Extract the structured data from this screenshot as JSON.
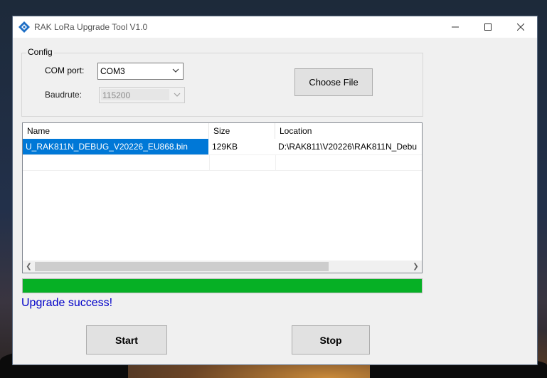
{
  "window": {
    "title": "RAK LoRa Upgrade Tool V1.0",
    "icon": "rak-diamond-icon",
    "controls": {
      "minimize": "minimize-icon",
      "maximize": "maximize-icon",
      "close": "close-icon"
    }
  },
  "config": {
    "group_title": "Config",
    "com_port_label": "COM port:",
    "com_port_value": "COM3",
    "baud_label": "Baudrute:",
    "baud_value": "115200",
    "choose_file_label": "Choose File"
  },
  "file_list": {
    "columns": [
      "Name",
      "Size",
      "Location"
    ],
    "rows": [
      {
        "name": "U_RAK811N_DEBUG_V20226_EU868.bin",
        "size": "129KB",
        "location": "D:\\RAK811\\V20226\\RAK811N_Debu",
        "selected": true
      }
    ]
  },
  "progress": {
    "value_fraction": 1.0,
    "color": "#06b025"
  },
  "status_text": "Upgrade success!",
  "actions": {
    "start_label": "Start",
    "stop_label": "Stop"
  },
  "colors": {
    "selection": "#0078d7",
    "status_text": "#0000c8"
  }
}
